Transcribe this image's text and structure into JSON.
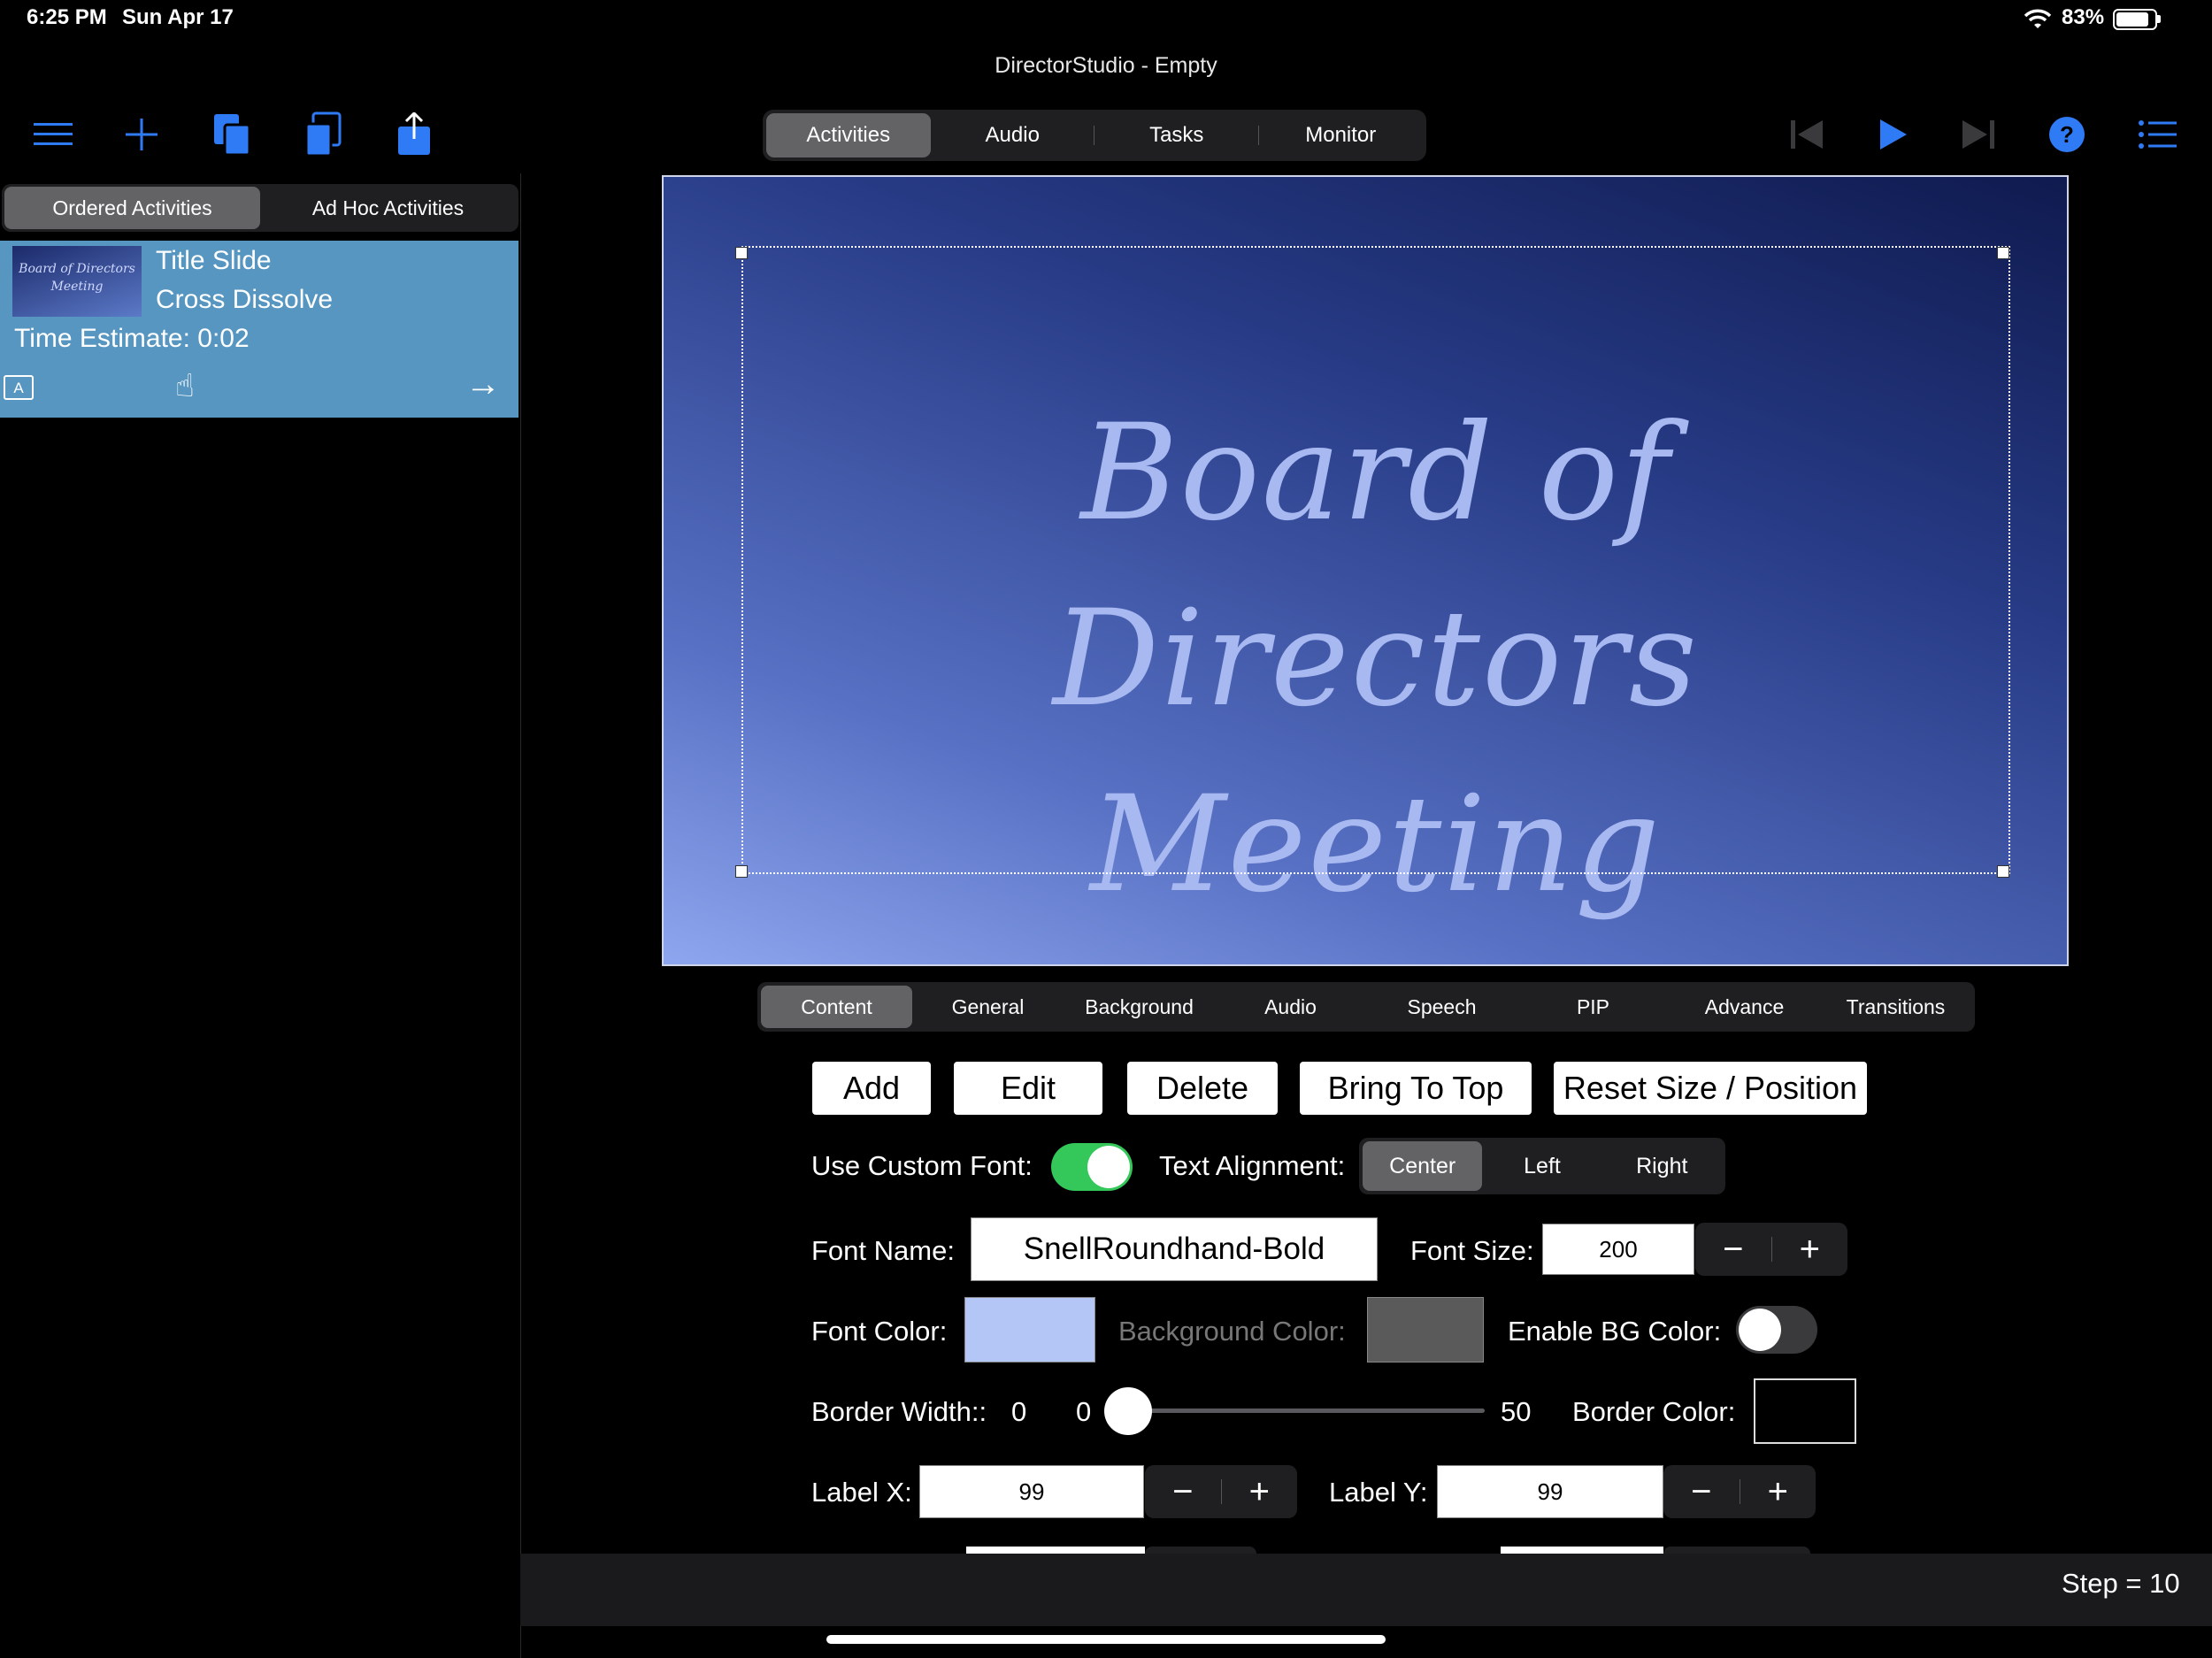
{
  "status_bar": {
    "time": "6:25 PM",
    "date": "Sun Apr 17",
    "battery_percent": "83%"
  },
  "window": {
    "title": "DirectorStudio - Empty"
  },
  "toolbar": {
    "left_icons": [
      "menu-icon",
      "add-icon",
      "copy-icon",
      "paste-icon",
      "share-icon"
    ],
    "right_icons": [
      "skip-back-icon",
      "play-icon",
      "skip-forward-icon",
      "help-icon",
      "list-icon"
    ],
    "accent_color": "#2f7bf6"
  },
  "main_tabs": {
    "items": [
      "Activities",
      "Audio",
      "Tasks",
      "Monitor"
    ],
    "selected": "Activities"
  },
  "left_tabs": {
    "items": [
      "Ordered Activities",
      "Ad Hoc Activities"
    ],
    "selected": "Ordered Activities"
  },
  "activity": {
    "thumbnail_text": "Board of Directors Meeting",
    "title": "Title Slide",
    "transition": "Cross Dissolve",
    "time_estimate": "Time Estimate: 0:02",
    "badge": "A",
    "background_color": "#5696c1"
  },
  "slide": {
    "line1": "Board of Directors",
    "line2": "Meeting",
    "text_color": "#a8b8f0"
  },
  "editor_tabs": {
    "items": [
      "Content",
      "General",
      "Background",
      "Audio",
      "Speech",
      "PIP",
      "Advance",
      "Transitions"
    ],
    "selected": "Content"
  },
  "actions": {
    "add": "Add",
    "edit": "Edit",
    "delete": "Delete",
    "bring_to_top": "Bring To Top",
    "reset": "Reset Size / Position"
  },
  "content": {
    "use_custom_font_label": "Use Custom Font:",
    "use_custom_font_on": true,
    "text_alignment_label": "Text Alignment:",
    "alignment_options": [
      "Center",
      "Left",
      "Right"
    ],
    "alignment_selected": "Center",
    "font_name_label": "Font Name:",
    "font_name_value": "SnellRoundhand-Bold",
    "font_size_label": "Font Size:",
    "font_size_value": "200",
    "font_color_label": "Font Color:",
    "font_color_value": "#b4c6f6",
    "background_color_label": "Background Color:",
    "background_color_value": "#5a5a5a",
    "enable_bg_color_label": "Enable BG Color:",
    "enable_bg_color_on": false,
    "border_width_label": "Border Width::",
    "border_width_value": "0",
    "slider_min": "0",
    "slider_max": "50",
    "slider_value": 0,
    "border_color_label": "Border Color:",
    "border_color_value": "#000000",
    "label_x_label": "Label X:",
    "label_x_value": "99",
    "label_y_label": "Label Y:",
    "label_y_value": "99"
  },
  "stepper": {
    "minus": "−",
    "plus": "+"
  },
  "footer": {
    "step": "Step = 10"
  }
}
